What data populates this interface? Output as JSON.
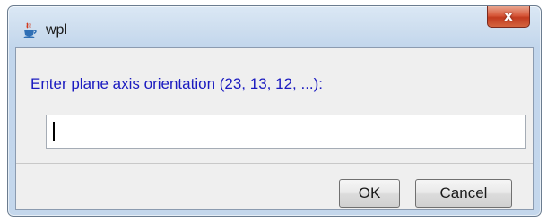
{
  "window": {
    "title": "wpl",
    "icon": "java-cup-icon",
    "close_glyph": "x"
  },
  "dialog": {
    "prompt": "Enter plane axis orientation (23, 13, 12, ...):",
    "input_value": "",
    "prompt_color": "#1b1bc0"
  },
  "buttons": {
    "ok_label": "OK",
    "cancel_label": "Cancel"
  }
}
